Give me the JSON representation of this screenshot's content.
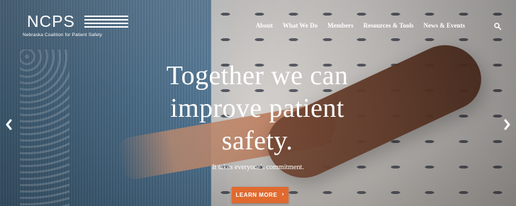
{
  "brand": {
    "logo_text": "NCPS",
    "tagline": "Nebraska Coalition for Patient Safety"
  },
  "nav": {
    "items": [
      "About",
      "What We Do",
      "Members",
      "Resources & Tools",
      "News & Events"
    ],
    "search_icon": "search-icon"
  },
  "hero": {
    "headline": "Together we can improve patient safety.",
    "subtext": "It takes everyone's commitment.",
    "cta_label": "LEARN MORE",
    "cta_icon": "chevron-right-icon",
    "prev_icon": "chevron-left-icon",
    "next_icon": "chevron-right-icon"
  },
  "colors": {
    "cta": "#e06a2f",
    "text": "#ffffff"
  }
}
